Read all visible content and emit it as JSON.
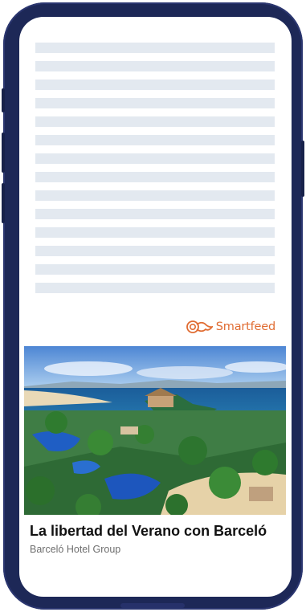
{
  "feed": {
    "skeleton_lines": 14,
    "brand_label": "Smartfeed",
    "brand_color": "#e06c32"
  },
  "ad": {
    "title": "La libertad del Verano con Barceló",
    "source": "Barceló Hotel Group"
  },
  "colors": {
    "frame": "#1d2857",
    "skeleton": "#e3e9f0"
  }
}
